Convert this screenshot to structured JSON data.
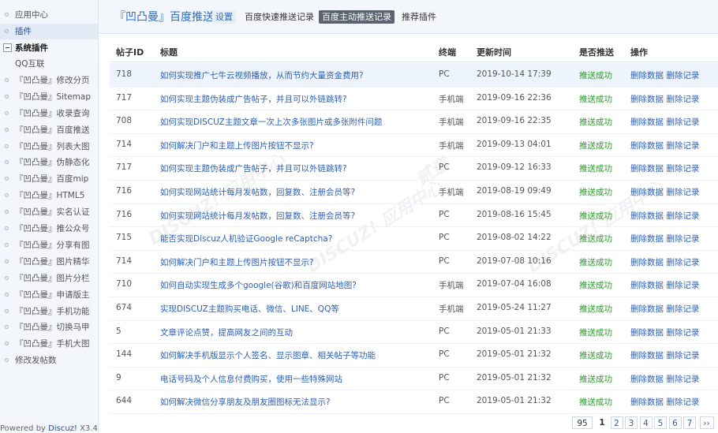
{
  "sidebar": {
    "items": [
      {
        "label": "应用中心"
      },
      {
        "label": "插件"
      }
    ],
    "group_label": "系统插件",
    "sub_items": [
      {
        "label": "QQ互联"
      },
      {
        "label": "『凹凸曼』修改分页"
      },
      {
        "label": "『凹凸曼』Sitemap"
      },
      {
        "label": "『凹凸曼』收录查询"
      },
      {
        "label": "『凹凸曼』百度推送"
      },
      {
        "label": "『凹凸曼』列表大图"
      },
      {
        "label": "『凹凸曼』伪静态化"
      },
      {
        "label": "『凹凸曼』百度mip"
      },
      {
        "label": "『凹凸曼』HTML5"
      },
      {
        "label": "『凹凸曼』实名认证"
      },
      {
        "label": "『凹凸曼』推公众号"
      },
      {
        "label": "『凹凸曼』分享有图"
      },
      {
        "label": "『凹凸曼』图片精华"
      },
      {
        "label": "『凹凸曼』图片分栏"
      },
      {
        "label": "『凹凸曼』申请版主"
      },
      {
        "label": "『凹凸曼』手机功能"
      },
      {
        "label": "『凹凸曼』切换马甲"
      },
      {
        "label": "『凹凸曼』手机大图"
      },
      {
        "label": "修改发帖数"
      }
    ],
    "powered_prefix": "Powered by ",
    "powered_link": "Discuz!",
    "powered_version": " X3.4"
  },
  "header": {
    "title": "『凹凸曼』百度推送",
    "tabs": [
      {
        "label": "设置"
      },
      {
        "label": "百度快速推送记录"
      },
      {
        "label": "百度主动推送记录"
      },
      {
        "label": "推荐插件"
      }
    ]
  },
  "table": {
    "headers": {
      "id": "帖子ID",
      "title": "标题",
      "terminal": "终端",
      "time": "更新时间",
      "pushed": "是否推送",
      "ops": "操作"
    },
    "delete_data": "删除数据",
    "delete_record": "删除记录",
    "rows": [
      {
        "id": "718",
        "title": "如何实现推广七牛云视频播放，从而节约大量资金费用?",
        "terminal": "PC",
        "time": "2019-10-14 17:39",
        "status": "推送成功"
      },
      {
        "id": "717",
        "title": "如何实现主题伪装成广告帖子，并且可以外链跳转?",
        "terminal": "手机端",
        "time": "2019-09-16 22:36",
        "status": "推送成功"
      },
      {
        "id": "708",
        "title": "如何实现DISCUZ主题文章一次上次多张图片或多张附件问题",
        "terminal": "手机端",
        "time": "2019-09-16 22:35",
        "status": "推送成功"
      },
      {
        "id": "714",
        "title": "如何解决门户和主题上传图片按钮不显示?",
        "terminal": "手机端",
        "time": "2019-09-13 04:01",
        "status": "推送成功"
      },
      {
        "id": "717",
        "title": "如何实现主题伪装成广告帖子，并且可以外链跳转?",
        "terminal": "PC",
        "time": "2019-09-12 16:33",
        "status": "推送成功"
      },
      {
        "id": "716",
        "title": "如何实现网站统计每月发帖数，回复数、注册会员等?",
        "terminal": "手机端",
        "time": "2019-08-19 09:49",
        "status": "推送成功"
      },
      {
        "id": "716",
        "title": "如何实现网站统计每月发帖数，回复数、注册会员等?",
        "terminal": "PC",
        "time": "2019-08-16 15:45",
        "status": "推送成功"
      },
      {
        "id": "715",
        "title": "能否实现Discuz人机验证Google reCaptcha?",
        "terminal": "PC",
        "time": "2019-08-02 14:22",
        "status": "推送成功"
      },
      {
        "id": "714",
        "title": "如何解决门户和主题上传图片按钮不显示?",
        "terminal": "PC",
        "time": "2019-07-08 10:16",
        "status": "推送成功"
      },
      {
        "id": "710",
        "title": "如何自动实现生成多个google(谷歌)和百度网站地图?",
        "terminal": "手机端",
        "time": "2019-07-04 16:08",
        "status": "推送成功"
      },
      {
        "id": "674",
        "title": "实现DISCUZ主题购买电话、微信、LINE、QQ等",
        "terminal": "手机端",
        "time": "2019-05-24 11:27",
        "status": "推送成功"
      },
      {
        "id": "5",
        "title": "文章评论点赞，提高网友之间的互动",
        "terminal": "PC",
        "time": "2019-05-01 21:33",
        "status": "推送成功"
      },
      {
        "id": "144",
        "title": "如何解决手机版显示个人签名、显示图章、相关帖子等功能",
        "terminal": "PC",
        "time": "2019-05-01 21:32",
        "status": "推送成功"
      },
      {
        "id": "9",
        "title": "电话号码及个人信息付费购买，使用一些特殊网站",
        "terminal": "PC",
        "time": "2019-05-01 21:32",
        "status": "推送成功"
      },
      {
        "id": "644",
        "title": "如何解决微信分享朋友及朋友圈图标无法显示?",
        "terminal": "PC",
        "time": "2019-05-01 21:32",
        "status": "推送成功"
      }
    ]
  },
  "pagination": {
    "total": "95",
    "pages": [
      "1",
      "2",
      "3",
      "4",
      "5",
      "6",
      "7"
    ],
    "current": "1",
    "next": "››"
  },
  "watermark": {
    "brand": "DISCUZ!",
    "cn": "应用中心",
    "domain": "addon.dismall.com",
    "author": "贰道"
  }
}
